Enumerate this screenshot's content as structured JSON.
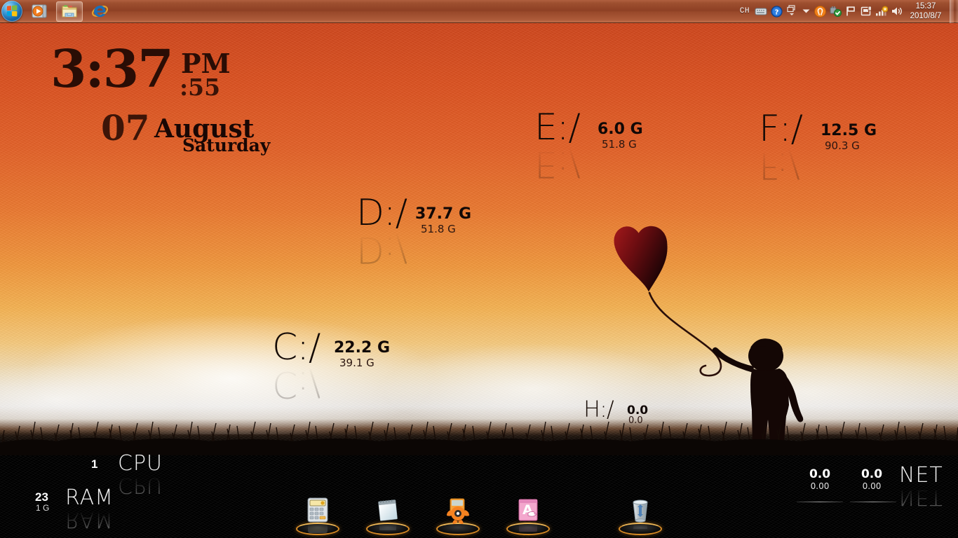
{
  "taskbar": {
    "start_button_label": "Start",
    "buttons": [
      {
        "name": "windows-media-player",
        "label": "Windows Media Player"
      },
      {
        "name": "windows-explorer",
        "label": "Windows Explorer",
        "active": true
      },
      {
        "name": "internet-explorer",
        "label": "Internet Explorer",
        "active": false
      }
    ],
    "tray": {
      "ime_label": "CH",
      "icons": [
        {
          "name": "keyboard-icon",
          "label": "Input Method Keyboard"
        },
        {
          "name": "help-icon",
          "label": "Help"
        },
        {
          "name": "ime-switch-icon",
          "label": "Switch Input Mode"
        },
        {
          "name": "show-hidden-icons-icon",
          "label": "Show hidden icons"
        },
        {
          "name": "avast-tray-icon",
          "label": "avast! Antivirus"
        },
        {
          "name": "safely-remove-hardware-icon",
          "label": "Safely Remove Hardware"
        },
        {
          "name": "action-center-flag-icon",
          "label": "Action Center"
        },
        {
          "name": "removable-media-icon",
          "label": "Removable Media"
        },
        {
          "name": "network-signal-icon",
          "label": "Network"
        },
        {
          "name": "volume-icon",
          "label": "Volume"
        }
      ],
      "clock_time": "15:37",
      "clock_date": "2010/8/7",
      "show_desktop_label": "Show desktop"
    }
  },
  "clock_gadget": {
    "time": "3:37",
    "meridiem": "PM",
    "seconds": ":55",
    "day": "07",
    "month": "August",
    "weekday": "Saturday"
  },
  "drives": [
    {
      "id": "c",
      "letter": "C",
      "separator": ":/",
      "free": "22.2 G",
      "total": "39.1 G"
    },
    {
      "id": "d",
      "letter": "D",
      "separator": ":/",
      "free": "37.7 G",
      "total": "51.8 G"
    },
    {
      "id": "e",
      "letter": "E",
      "separator": ":/",
      "free": "6.0 G",
      "total": "51.8 G"
    },
    {
      "id": "f",
      "letter": "F",
      "separator": ":/",
      "free": "12.5 G",
      "total": "90.3 G"
    },
    {
      "id": "h",
      "letter": "H",
      "separator": ":/",
      "free": "0.0",
      "total": "0.0"
    }
  ],
  "system_gadgets": {
    "cpu": {
      "label": "CPU",
      "value": "1"
    },
    "ram": {
      "label": "RAM",
      "value": "23",
      "sub": "1 G"
    },
    "net": {
      "label": "NET",
      "download": {
        "big": "0.0",
        "small": "0.00"
      },
      "upload": {
        "big": "0.0",
        "small": "0.00"
      }
    }
  },
  "dock": {
    "items": [
      {
        "name": "calculator",
        "label": "Calculator"
      },
      {
        "name": "notepad",
        "label": "Notepad"
      },
      {
        "name": "avast-antivirus",
        "label": "avast! Antivirus"
      },
      {
        "name": "microsoft-access",
        "label": "Microsoft Access"
      },
      {
        "name": "recycle-bin",
        "label": "Recycle Bin"
      }
    ]
  },
  "wallpaper": {
    "description": "Silhouette of a boy holding a heart-shaped balloon over a grass field at sunset",
    "sky_top_color": "#c8441f",
    "sky_mid_color": "#f2993f",
    "horizon_color": "#eae6e2",
    "ground_color": "#000000",
    "balloon_color": "#6b0f12"
  }
}
